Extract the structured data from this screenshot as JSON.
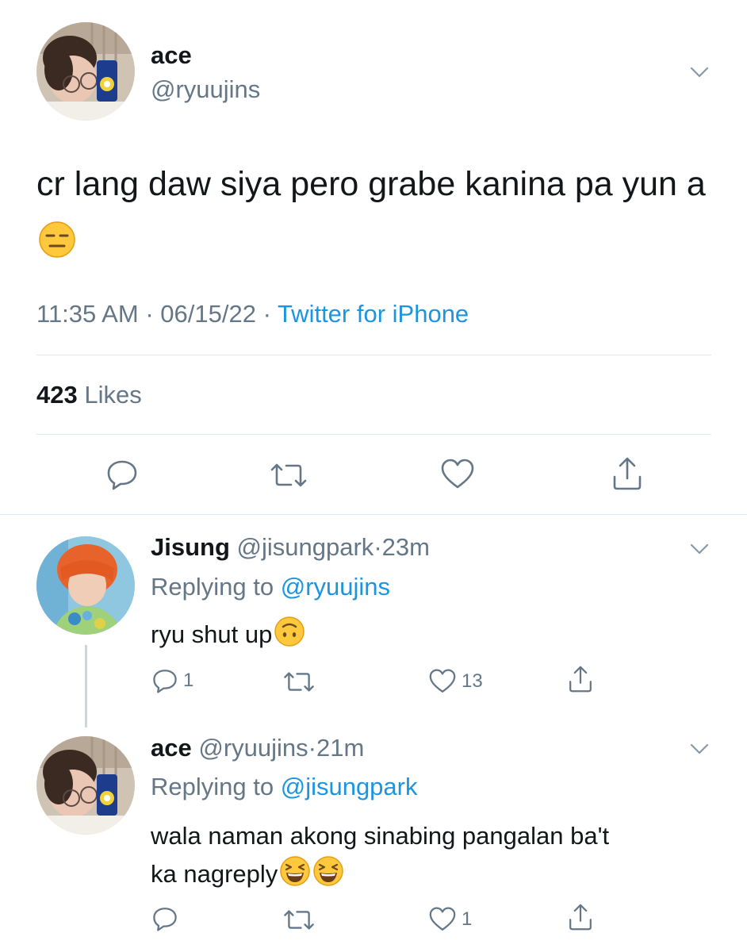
{
  "main_tweet": {
    "name": "ace",
    "handle": "@ryuujins",
    "text": "cr lang daw siya pero grabe kanina pa yun a",
    "text_emoji": "expressionless-face",
    "time": "11:35 AM",
    "date": "06/15/22",
    "source": "Twitter for iPhone",
    "likes_count": "423",
    "likes_label": "Likes"
  },
  "replies": [
    {
      "name": "Jisung",
      "handle": "@jisungpark",
      "age": "23m",
      "replying_prefix": "Replying to",
      "replying_to": "@ryuujins",
      "text": "ryu shut up",
      "text_emoji": "upside-down-face",
      "reply_count": "1",
      "retweet_count": "",
      "like_count": "13"
    },
    {
      "name": "ace",
      "handle": "@ryuujins",
      "age": "21m",
      "replying_prefix": "Replying to",
      "replying_to": "@jisungpark",
      "text_line1": "wala naman akong sinabing pangalan ba't",
      "text_line2": "ka nagreply",
      "text_emoji": "grinning-squinting-face",
      "reply_count": "",
      "retweet_count": "",
      "like_count": "1"
    }
  ],
  "colors": {
    "link": "#1b95e0",
    "muted": "#657786",
    "text": "#14171a",
    "divider": "#e1e8ed"
  },
  "separator": "·"
}
